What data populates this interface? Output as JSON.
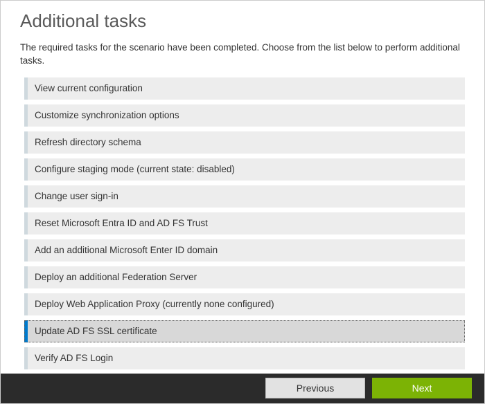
{
  "page": {
    "title": "Additional tasks",
    "description": "The required tasks for the scenario have been completed. Choose from the list below to perform additional tasks."
  },
  "tasks": [
    {
      "label": "View current configuration",
      "selected": false
    },
    {
      "label": "Customize synchronization options",
      "selected": false
    },
    {
      "label": "Refresh directory schema",
      "selected": false
    },
    {
      "label": "Configure staging mode (current state: disabled)",
      "selected": false
    },
    {
      "label": "Change user sign-in",
      "selected": false
    },
    {
      "label": "Reset Microsoft Entra ID and AD FS Trust",
      "selected": false
    },
    {
      "label": "Add an additional Microsoft Enter ID domain",
      "selected": false
    },
    {
      "label": "Deploy an additional Federation Server",
      "selected": false
    },
    {
      "label": "Deploy Web Application Proxy (currently none configured)",
      "selected": false
    },
    {
      "label": "Update AD FS SSL certificate",
      "selected": true
    },
    {
      "label": "Verify AD FS Login",
      "selected": false
    }
  ],
  "footer": {
    "previous": "Previous",
    "next": "Next"
  }
}
